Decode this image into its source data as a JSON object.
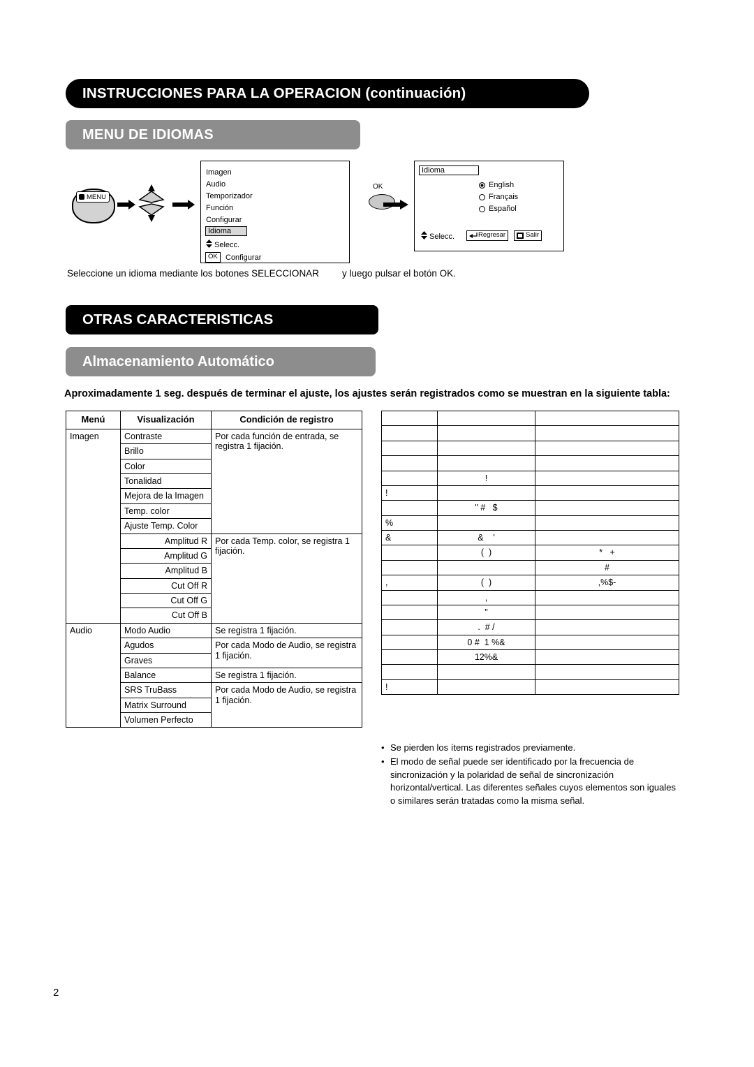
{
  "page": {
    "number": "2"
  },
  "headers": {
    "main_banner": "INSTRUCCIONES PARA LA OPERACION (continuación)",
    "grey_banner": "MENU DE IDIOMAS",
    "black_banner_2": "OTRAS CARACTERISTICAS",
    "grey_banner_2": "Almacenamiento Automático"
  },
  "diagram": {
    "menu_button_label": "MENU",
    "ok_button_label": "OK",
    "osd1": {
      "items": [
        "Imagen",
        "Audio",
        "Temporizador",
        "Función",
        "Configurar"
      ],
      "highlight": "Idioma",
      "select_hint": "Selecc.",
      "ok_box": "OK",
      "ok_hint": "Configurar"
    },
    "osd2": {
      "title": "Idioma",
      "options": [
        "English",
        "Français",
        "Español"
      ],
      "selected_index": 0,
      "footer_select": "Selecc.",
      "footer_back": "Regresar",
      "footer_exit": "Salir"
    },
    "caption_left": "Seleccione un idioma mediante los botones SELECCIONAR",
    "caption_right": "y luego pulsar el botón OK."
  },
  "intro_text": "Aproximadamente 1 seg. después de terminar el ajuste, los ajustes serán registrados como se muestran en la siguiente tabla:",
  "left_table": {
    "headers": [
      "Menú",
      "Visualización",
      "Condición de registro"
    ],
    "rows": [
      {
        "menu": "Imagen",
        "display": "Contraste",
        "condition": "Por cada función de entrada, se registra 1 fijación.",
        "cond_span": 7,
        "menu_span": 13,
        "align": "left"
      },
      {
        "menu": "",
        "display": "Brillo",
        "align": "left"
      },
      {
        "menu": "",
        "display": "Color",
        "align": "left"
      },
      {
        "menu": "",
        "display": "Tonalidad",
        "align": "left"
      },
      {
        "menu": "",
        "display": "Mejora de la Imagen",
        "align": "left"
      },
      {
        "menu": "",
        "display": "Temp. color",
        "align": "left"
      },
      {
        "menu": "",
        "display": "Ajuste Temp. Color",
        "align": "left"
      },
      {
        "menu": "",
        "display": "Amplitud R",
        "condition": "Por cada Temp. color, se registra 1 fijación.",
        "cond_span": 6,
        "align": "right"
      },
      {
        "menu": "",
        "display": "Amplitud G",
        "align": "right"
      },
      {
        "menu": "",
        "display": "Amplitud B",
        "align": "right"
      },
      {
        "menu": "",
        "display": "Cut Off R",
        "align": "right"
      },
      {
        "menu": "",
        "display": "Cut Off G",
        "align": "right"
      },
      {
        "menu": "",
        "display": "Cut Off B",
        "align": "right"
      },
      {
        "menu": "Audio",
        "display": "Modo Audio",
        "condition": "Se registra 1 fijación.",
        "cond_span": 1,
        "menu_span": 7,
        "align": "left"
      },
      {
        "menu": "",
        "display": "Agudos",
        "condition": "Por cada Modo de Audio, se registra 1 fijación.",
        "cond_span": 2,
        "align": "left"
      },
      {
        "menu": "",
        "display": "Graves",
        "align": "left"
      },
      {
        "menu": "",
        "display": "Balance",
        "condition": "Se registra 1 fijación.",
        "cond_span": 1,
        "align": "left"
      },
      {
        "menu": "",
        "display": "SRS TruBass",
        "condition": "Por cada Modo de Audio, se registra 1 fijación.",
        "cond_span": 3,
        "align": "left"
      },
      {
        "menu": "",
        "display": "Matrix Surround",
        "align": "left"
      },
      {
        "menu": "",
        "display": "Volumen Perfecto",
        "align": "left"
      }
    ]
  },
  "right_table": {
    "rows": [
      {
        "c1": "",
        "c2": "",
        "c3": ""
      },
      {
        "c1": "",
        "c2": "",
        "c3": ""
      },
      {
        "c1": "",
        "c2": "",
        "c3": ""
      },
      {
        "c1": "",
        "c2": "",
        "c3": ""
      },
      {
        "c1": "",
        "c2": "!",
        "c3": ""
      },
      {
        "c1": "!",
        "c2": "",
        "c3": ""
      },
      {
        "c1": "",
        "c2": "\" #   $",
        "c3": ""
      },
      {
        "c1": "%",
        "c2": "",
        "c3": ""
      },
      {
        "c1": "&",
        "c2": "&    '",
        "c3": ""
      },
      {
        "c1": "",
        "c2": "(  )",
        "c3": "*   +"
      },
      {
        "c1": "",
        "c2": "",
        "c3": "#"
      },
      {
        "c1": ",",
        "c2": "(  )",
        "c3": ",%$-"
      },
      {
        "c1": "",
        "c2": ",",
        "c3": ""
      },
      {
        "c1": "",
        "c2": "\"",
        "c3": ""
      },
      {
        "c1": "",
        "c2": ".  # /",
        "c3": ""
      },
      {
        "c1": "",
        "c2": "0 #  1 %&",
        "c3": ""
      },
      {
        "c1": "",
        "c2": "12%&",
        "c3": ""
      },
      {
        "c1": "",
        "c2": "",
        "c3": ""
      },
      {
        "c1": "!",
        "c2": "",
        "c3": ""
      }
    ]
  },
  "notes": [
    "Se pierden los ítems registrados previamente.",
    "El modo de señal puede ser identificado por la frecuencia de sincronización y la polaridad de señal de sincronización horizontal/vertical. Las diferentes señales cuyos elementos son iguales o similares serán tratadas como la misma señal."
  ]
}
